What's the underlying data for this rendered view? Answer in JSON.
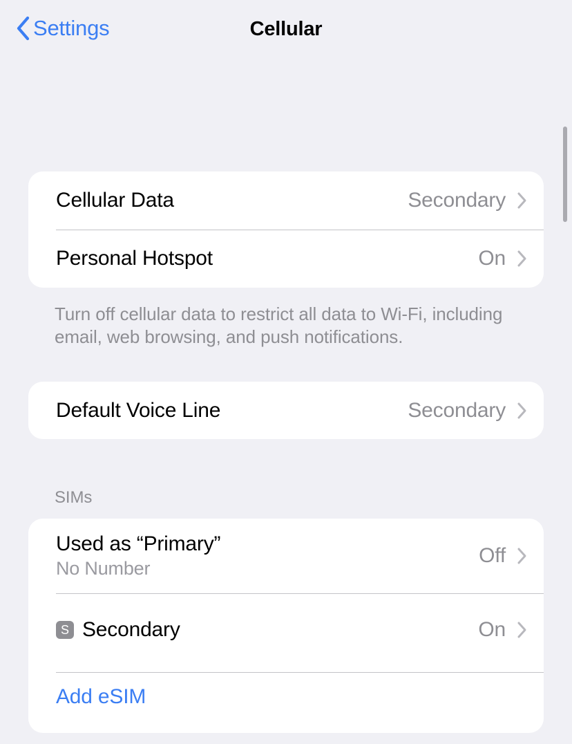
{
  "nav": {
    "back_label": "Settings",
    "back_icon": "chevron-left-icon",
    "title": "Cellular"
  },
  "sections": [
    {
      "id": "data-section",
      "rows": [
        {
          "title": "Cellular Data",
          "value": "Secondary",
          "accessory": "chevron-right-icon"
        },
        {
          "title": "Personal Hotspot",
          "value": "On",
          "accessory": "chevron-right-icon"
        }
      ],
      "footer": "Turn off cellular data to restrict all data to Wi-Fi, including email, web browsing, and push notifications."
    },
    {
      "id": "voice-section",
      "rows": [
        {
          "title": "Default Voice Line",
          "value": "Secondary",
          "accessory": "chevron-right-icon"
        }
      ]
    },
    {
      "id": "sims-section",
      "header": "SIMs",
      "rows": [
        {
          "title": "Used as “Primary”",
          "subtitle": "No Number",
          "value": "Off",
          "accessory": "chevron-right-icon"
        },
        {
          "badge": "S",
          "title": "Secondary",
          "value": "On",
          "accessory": "chevron-right-icon"
        },
        {
          "title": "Add eSIM",
          "action": true
        }
      ]
    }
  ],
  "colors": {
    "background": "#f0f0f5",
    "card": "#ffffff",
    "accent_blue": "#3b7ef3",
    "secondary_text": "#8e8e93",
    "separator": "#c3c3c7",
    "badge_gray": "#8e8e93"
  },
  "scrollbar": {
    "visible": true
  }
}
